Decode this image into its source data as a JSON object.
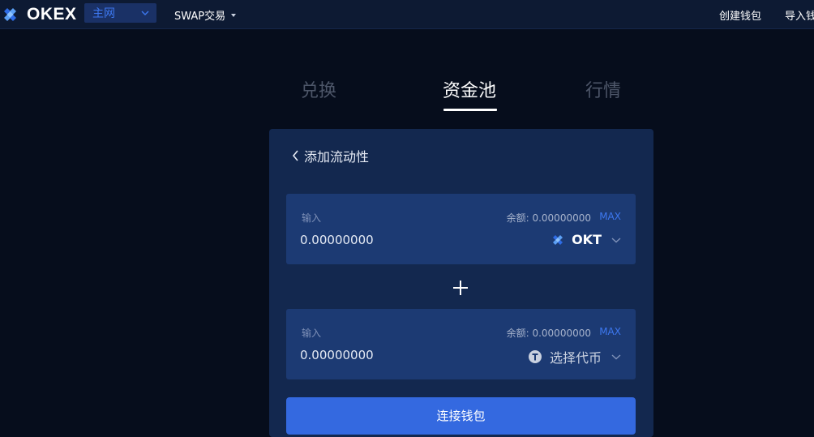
{
  "header": {
    "logo_text": "OKEX",
    "network": "主网",
    "swap_menu": "SWAP交易",
    "create_wallet": "创建钱包",
    "import_wallet": "导入钱"
  },
  "tabs": [
    {
      "label": "兑换",
      "active": false
    },
    {
      "label": "资金池",
      "active": true
    },
    {
      "label": "行情",
      "active": false
    }
  ],
  "card": {
    "back_title": "添加流动性",
    "inputs": [
      {
        "label": "输入",
        "balance": "余额: 0.00000000",
        "max": "MAX",
        "value": "0.00000000",
        "token": "OKT",
        "token_icon": "okt-token-icon"
      },
      {
        "label": "输入",
        "balance": "余额: 0.00000000",
        "max": "MAX",
        "value": "0.00000000",
        "token": "选择代币",
        "token_icon": "token-placeholder-icon"
      }
    ],
    "plus_icon": "plus-icon",
    "connect_button": "连接钱包"
  },
  "colors": {
    "background": "#060d1c",
    "topbar": "#0d1a33",
    "card": "#13284f",
    "input_box": "#1c3a73",
    "accent": "#3d78f0",
    "button": "#3469e0",
    "tab_inactive": "#4d5669"
  }
}
